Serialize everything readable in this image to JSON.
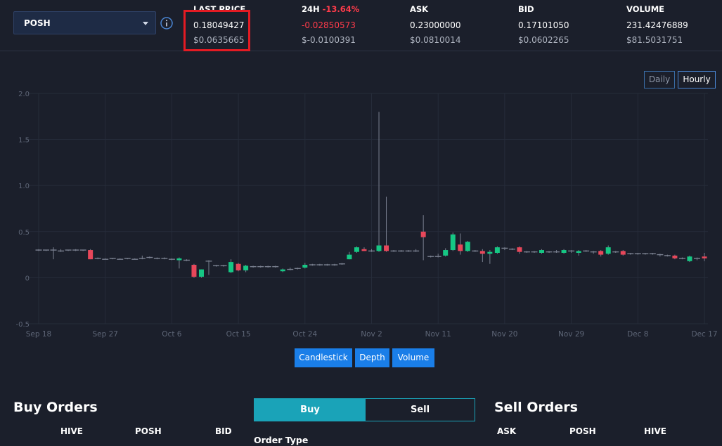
{
  "token_selector": {
    "value": "POSH"
  },
  "stats": {
    "last_price": {
      "label": "LAST PRICE",
      "value": "0.18049427",
      "usd": "$0.0635665"
    },
    "change_24h": {
      "label": "24H",
      "pct": "-13.64%",
      "value": "-0.02850573",
      "usd": "$-0.0100391"
    },
    "ask": {
      "label": "ASK",
      "value": "0.23000000",
      "usd": "$0.0810014"
    },
    "bid": {
      "label": "BID",
      "value": "0.17101050",
      "usd": "$0.0602265"
    },
    "volume": {
      "label": "VOLUME",
      "value": "231.42476889",
      "usd": "$81.5031751"
    }
  },
  "period_buttons": {
    "daily": "Daily",
    "hourly": "Hourly",
    "active": "Hourly"
  },
  "chart_tabs": {
    "candlestick": "Candlestick",
    "depth": "Depth",
    "volume": "Volume"
  },
  "buy_orders": {
    "title": "Buy Orders",
    "columns": [
      "HIVE",
      "POSH",
      "BID"
    ]
  },
  "sell_orders": {
    "title": "Sell Orders",
    "columns": [
      "ASK",
      "POSH",
      "HIVE"
    ]
  },
  "trade_form": {
    "buy_label": "Buy",
    "sell_label": "Sell",
    "order_type_label": "Order Type"
  },
  "colors": {
    "up": "#16c784",
    "down": "#e8475a",
    "accent": "#1a7ee8",
    "teal": "#1aa3b8",
    "highlight": "#e41b23"
  },
  "chart_data": {
    "type": "candlestick",
    "x_tick_labels": [
      "Sep 18",
      "Sep 27",
      "Oct 6",
      "Oct 15",
      "Oct 24",
      "Nov 2",
      "Nov 11",
      "Nov 20",
      "Nov 29",
      "Dec 8",
      "Dec 17"
    ],
    "y_ticks": [
      2.0,
      1.5,
      1.0,
      0.5,
      0,
      -0.5
    ],
    "y_tick_labels": [
      "2.0",
      "1.5",
      "1.0",
      "0.5",
      "0",
      "-0.5"
    ],
    "ylim": [
      -0.5,
      2.0
    ],
    "grid": true,
    "x_start_label": "Sep 18",
    "day_span": 90,
    "candles": [
      {
        "d": 0,
        "o": 0.3,
        "h": 0.31,
        "l": 0.29,
        "c": 0.3
      },
      {
        "d": 1,
        "o": 0.3,
        "h": 0.3,
        "l": 0.29,
        "c": 0.3
      },
      {
        "d": 2,
        "o": 0.3,
        "h": 0.33,
        "l": 0.2,
        "c": 0.29
      },
      {
        "d": 3,
        "o": 0.29,
        "h": 0.31,
        "l": 0.28,
        "c": 0.3
      },
      {
        "d": 4,
        "o": 0.3,
        "h": 0.3,
        "l": 0.29,
        "c": 0.3
      },
      {
        "d": 5,
        "o": 0.3,
        "h": 0.31,
        "l": 0.29,
        "c": 0.3
      },
      {
        "d": 6,
        "o": 0.3,
        "h": 0.3,
        "l": 0.29,
        "c": 0.3
      },
      {
        "d": 7,
        "o": 0.3,
        "h": 0.31,
        "l": 0.2,
        "c": 0.2
      },
      {
        "d": 8,
        "o": 0.21,
        "h": 0.22,
        "l": 0.2,
        "c": 0.2
      },
      {
        "d": 9,
        "o": 0.2,
        "h": 0.21,
        "l": 0.2,
        "c": 0.21
      },
      {
        "d": 10,
        "o": 0.21,
        "h": 0.21,
        "l": 0.2,
        "c": 0.2
      },
      {
        "d": 11,
        "o": 0.2,
        "h": 0.21,
        "l": 0.2,
        "c": 0.21
      },
      {
        "d": 12,
        "o": 0.21,
        "h": 0.21,
        "l": 0.2,
        "c": 0.2
      },
      {
        "d": 13,
        "o": 0.2,
        "h": 0.21,
        "l": 0.2,
        "c": 0.21
      },
      {
        "d": 14,
        "o": 0.21,
        "h": 0.24,
        "l": 0.2,
        "c": 0.22
      },
      {
        "d": 15,
        "o": 0.22,
        "h": 0.23,
        "l": 0.21,
        "c": 0.21
      },
      {
        "d": 16,
        "o": 0.21,
        "h": 0.22,
        "l": 0.2,
        "c": 0.21
      },
      {
        "d": 17,
        "o": 0.21,
        "h": 0.22,
        "l": 0.2,
        "c": 0.2
      },
      {
        "d": 18,
        "o": 0.2,
        "h": 0.21,
        "l": 0.19,
        "c": 0.2
      },
      {
        "d": 19,
        "o": 0.19,
        "h": 0.22,
        "l": 0.1,
        "c": 0.21
      },
      {
        "d": 20,
        "o": 0.19,
        "h": 0.2,
        "l": 0.18,
        "c": 0.19
      },
      {
        "d": 21,
        "o": 0.14,
        "h": 0.15,
        "l": 0.0,
        "c": 0.01
      },
      {
        "d": 22,
        "o": 0.01,
        "h": 0.09,
        "l": 0.0,
        "c": 0.09
      },
      {
        "d": 23,
        "o": 0.18,
        "h": 0.19,
        "l": 0.03,
        "c": 0.18
      },
      {
        "d": 24,
        "o": 0.13,
        "h": 0.14,
        "l": 0.12,
        "c": 0.13
      },
      {
        "d": 25,
        "o": 0.13,
        "h": 0.14,
        "l": 0.12,
        "c": 0.13
      },
      {
        "d": 26,
        "o": 0.06,
        "h": 0.2,
        "l": 0.05,
        "c": 0.17
      },
      {
        "d": 27,
        "o": 0.15,
        "h": 0.16,
        "l": 0.07,
        "c": 0.08
      },
      {
        "d": 28,
        "o": 0.08,
        "h": 0.14,
        "l": 0.06,
        "c": 0.13
      },
      {
        "d": 29,
        "o": 0.12,
        "h": 0.13,
        "l": 0.11,
        "c": 0.12
      },
      {
        "d": 30,
        "o": 0.12,
        "h": 0.13,
        "l": 0.11,
        "c": 0.12
      },
      {
        "d": 31,
        "o": 0.12,
        "h": 0.13,
        "l": 0.11,
        "c": 0.12
      },
      {
        "d": 32,
        "o": 0.12,
        "h": 0.13,
        "l": 0.11,
        "c": 0.12
      },
      {
        "d": 33,
        "o": 0.07,
        "h": 0.1,
        "l": 0.06,
        "c": 0.09
      },
      {
        "d": 34,
        "o": 0.09,
        "h": 0.11,
        "l": 0.08,
        "c": 0.1
      },
      {
        "d": 35,
        "o": 0.1,
        "h": 0.11,
        "l": 0.09,
        "c": 0.11
      },
      {
        "d": 36,
        "o": 0.11,
        "h": 0.16,
        "l": 0.1,
        "c": 0.14
      },
      {
        "d": 37,
        "o": 0.14,
        "h": 0.15,
        "l": 0.13,
        "c": 0.14
      },
      {
        "d": 38,
        "o": 0.14,
        "h": 0.15,
        "l": 0.13,
        "c": 0.14
      },
      {
        "d": 39,
        "o": 0.14,
        "h": 0.15,
        "l": 0.13,
        "c": 0.14
      },
      {
        "d": 40,
        "o": 0.14,
        "h": 0.15,
        "l": 0.13,
        "c": 0.15
      },
      {
        "d": 41,
        "o": 0.15,
        "h": 0.16,
        "l": 0.14,
        "c": 0.15
      },
      {
        "d": 42,
        "o": 0.2,
        "h": 0.28,
        "l": 0.2,
        "c": 0.25
      },
      {
        "d": 43,
        "o": 0.28,
        "h": 0.34,
        "l": 0.27,
        "c": 0.33
      },
      {
        "d": 44,
        "o": 0.31,
        "h": 0.33,
        "l": 0.29,
        "c": 0.29
      },
      {
        "d": 45,
        "o": 0.29,
        "h": 0.31,
        "l": 0.28,
        "c": 0.3
      },
      {
        "d": 46,
        "o": 0.29,
        "h": 1.8,
        "l": 0.28,
        "c": 0.35
      },
      {
        "d": 47,
        "o": 0.35,
        "h": 0.88,
        "l": 0.28,
        "c": 0.29
      },
      {
        "d": 48,
        "o": 0.29,
        "h": 0.3,
        "l": 0.28,
        "c": 0.29
      },
      {
        "d": 49,
        "o": 0.29,
        "h": 0.3,
        "l": 0.28,
        "c": 0.29
      },
      {
        "d": 50,
        "o": 0.29,
        "h": 0.3,
        "l": 0.28,
        "c": 0.29
      },
      {
        "d": 51,
        "o": 0.29,
        "h": 0.31,
        "l": 0.28,
        "c": 0.3
      },
      {
        "d": 52,
        "o": 0.5,
        "h": 0.68,
        "l": 0.19,
        "c": 0.44
      },
      {
        "d": 53,
        "o": 0.23,
        "h": 0.24,
        "l": 0.22,
        "c": 0.23
      },
      {
        "d": 54,
        "o": 0.23,
        "h": 0.26,
        "l": 0.22,
        "c": 0.24
      },
      {
        "d": 55,
        "o": 0.24,
        "h": 0.32,
        "l": 0.23,
        "c": 0.3
      },
      {
        "d": 56,
        "o": 0.3,
        "h": 0.49,
        "l": 0.29,
        "c": 0.47
      },
      {
        "d": 57,
        "o": 0.36,
        "h": 0.48,
        "l": 0.25,
        "c": 0.29
      },
      {
        "d": 58,
        "o": 0.29,
        "h": 0.4,
        "l": 0.28,
        "c": 0.39
      },
      {
        "d": 59,
        "o": 0.29,
        "h": 0.3,
        "l": 0.28,
        "c": 0.29
      },
      {
        "d": 60,
        "o": 0.29,
        "h": 0.31,
        "l": 0.17,
        "c": 0.26
      },
      {
        "d": 61,
        "o": 0.26,
        "h": 0.3,
        "l": 0.15,
        "c": 0.28
      },
      {
        "d": 62,
        "o": 0.27,
        "h": 0.34,
        "l": 0.26,
        "c": 0.33
      },
      {
        "d": 63,
        "o": 0.32,
        "h": 0.33,
        "l": 0.3,
        "c": 0.31
      },
      {
        "d": 64,
        "o": 0.31,
        "h": 0.32,
        "l": 0.3,
        "c": 0.31
      },
      {
        "d": 65,
        "o": 0.33,
        "h": 0.34,
        "l": 0.26,
        "c": 0.28
      },
      {
        "d": 66,
        "o": 0.28,
        "h": 0.29,
        "l": 0.27,
        "c": 0.28
      },
      {
        "d": 67,
        "o": 0.28,
        "h": 0.29,
        "l": 0.27,
        "c": 0.28
      },
      {
        "d": 68,
        "o": 0.27,
        "h": 0.31,
        "l": 0.26,
        "c": 0.3
      },
      {
        "d": 69,
        "o": 0.28,
        "h": 0.29,
        "l": 0.27,
        "c": 0.28
      },
      {
        "d": 70,
        "o": 0.28,
        "h": 0.3,
        "l": 0.27,
        "c": 0.29
      },
      {
        "d": 71,
        "o": 0.27,
        "h": 0.31,
        "l": 0.26,
        "c": 0.3
      },
      {
        "d": 72,
        "o": 0.29,
        "h": 0.3,
        "l": 0.27,
        "c": 0.28
      },
      {
        "d": 73,
        "o": 0.27,
        "h": 0.3,
        "l": 0.24,
        "c": 0.29
      },
      {
        "d": 74,
        "o": 0.29,
        "h": 0.3,
        "l": 0.28,
        "c": 0.28
      },
      {
        "d": 75,
        "o": 0.28,
        "h": 0.29,
        "l": 0.26,
        "c": 0.27
      },
      {
        "d": 76,
        "o": 0.29,
        "h": 0.3,
        "l": 0.23,
        "c": 0.25
      },
      {
        "d": 77,
        "o": 0.26,
        "h": 0.35,
        "l": 0.25,
        "c": 0.33
      },
      {
        "d": 78,
        "o": 0.28,
        "h": 0.29,
        "l": 0.27,
        "c": 0.28
      },
      {
        "d": 79,
        "o": 0.29,
        "h": 0.3,
        "l": 0.24,
        "c": 0.25
      },
      {
        "d": 80,
        "o": 0.26,
        "h": 0.27,
        "l": 0.25,
        "c": 0.26
      },
      {
        "d": 81,
        "o": 0.26,
        "h": 0.27,
        "l": 0.25,
        "c": 0.26
      },
      {
        "d": 82,
        "o": 0.26,
        "h": 0.27,
        "l": 0.25,
        "c": 0.26
      },
      {
        "d": 83,
        "o": 0.26,
        "h": 0.27,
        "l": 0.25,
        "c": 0.26
      },
      {
        "d": 84,
        "o": 0.25,
        "h": 0.26,
        "l": 0.23,
        "c": 0.24
      },
      {
        "d": 85,
        "o": 0.24,
        "h": 0.25,
        "l": 0.23,
        "c": 0.24
      },
      {
        "d": 86,
        "o": 0.24,
        "h": 0.25,
        "l": 0.2,
        "c": 0.21
      },
      {
        "d": 87,
        "o": 0.21,
        "h": 0.22,
        "l": 0.2,
        "c": 0.21
      },
      {
        "d": 88,
        "o": 0.18,
        "h": 0.24,
        "l": 0.17,
        "c": 0.23
      },
      {
        "d": 89,
        "o": 0.21,
        "h": 0.22,
        "l": 0.19,
        "c": 0.21
      },
      {
        "d": 90,
        "o": 0.23,
        "h": 0.27,
        "l": 0.18,
        "c": 0.21
      }
    ]
  }
}
